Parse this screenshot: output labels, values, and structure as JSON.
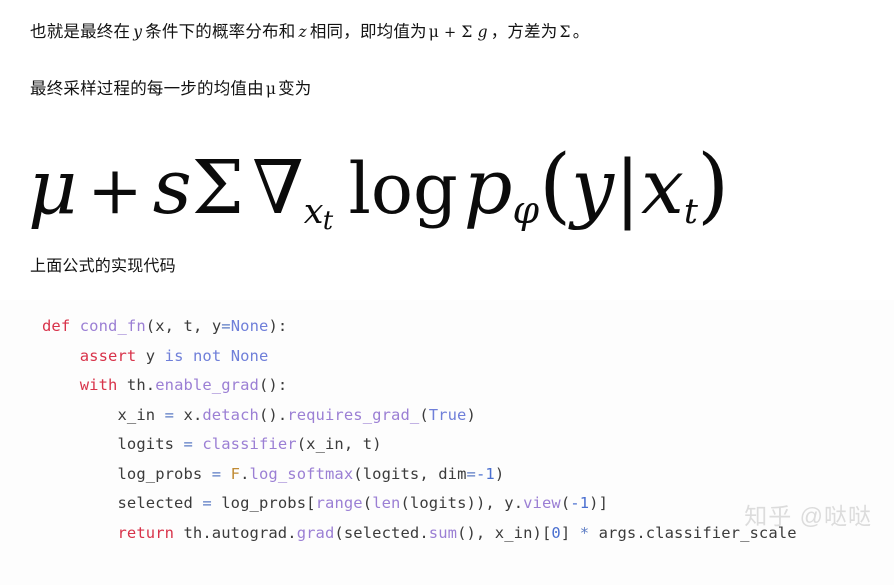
{
  "article": {
    "paragraph_1": {
      "segment_1": "也就是最终在",
      "math_1": "y",
      "segment_2": "条件下的概率分布和",
      "math_2": "z",
      "segment_3": "相同，即均值为",
      "math_3": "μ",
      "math_op": "+",
      "math_4": "Σ",
      "math_5": "g",
      "segment_4": "，方差为",
      "math_6": "Σ",
      "segment_5": "。"
    },
    "paragraph_2": {
      "segment_1": "最终采样过程的每一步的均值由",
      "math_1": "μ",
      "segment_2": "变为"
    },
    "paragraph_3": {
      "text": "上面公式的实现代码"
    }
  },
  "formula": {
    "latex": "\\mu + s\\Sigma \\nabla_{x_t} \\log p_\\phi(y|x_t)",
    "plain": "μ + sΣ ∇_{x_t} log p_φ(y|x_t)",
    "tokens": {
      "mu": "μ",
      "plus": "+",
      "s": "s",
      "sigma": "Σ",
      "nabla": "∇",
      "nabla_sub_x": "x",
      "nabla_sub_t": "t",
      "log": "log",
      "p": "p",
      "phi": "φ",
      "lparen": "(",
      "y": "y",
      "bar": "|",
      "x": "x",
      "x_sub_t": "t",
      "rparen": ")"
    }
  },
  "code": {
    "language": "python",
    "lines": [
      {
        "indent": 0,
        "tokens": [
          {
            "t": "def",
            "c": "t-kw"
          },
          {
            "t": " ",
            "c": "t-punc"
          },
          {
            "t": "cond_fn",
            "c": "t-fn"
          },
          {
            "t": "(",
            "c": "t-punc"
          },
          {
            "t": "x",
            "c": "t-var"
          },
          {
            "t": ", ",
            "c": "t-punc"
          },
          {
            "t": "t",
            "c": "t-var"
          },
          {
            "t": ", ",
            "c": "t-punc"
          },
          {
            "t": "y",
            "c": "t-var"
          },
          {
            "t": "=",
            "c": "t-op"
          },
          {
            "t": "None",
            "c": "t-bi"
          },
          {
            "t": "):",
            "c": "t-punc"
          }
        ]
      },
      {
        "indent": 1,
        "tokens": [
          {
            "t": "assert",
            "c": "t-kw"
          },
          {
            "t": " ",
            "c": "t-punc"
          },
          {
            "t": "y",
            "c": "t-var"
          },
          {
            "t": " ",
            "c": "t-punc"
          },
          {
            "t": "is",
            "c": "t-bi"
          },
          {
            "t": " ",
            "c": "t-punc"
          },
          {
            "t": "not",
            "c": "t-bi"
          },
          {
            "t": " ",
            "c": "t-punc"
          },
          {
            "t": "None",
            "c": "t-bi"
          }
        ]
      },
      {
        "indent": 1,
        "tokens": [
          {
            "t": "with",
            "c": "t-kw"
          },
          {
            "t": " th.",
            "c": "t-punc"
          },
          {
            "t": "enable_grad",
            "c": "t-fn"
          },
          {
            "t": "():",
            "c": "t-punc"
          }
        ]
      },
      {
        "indent": 2,
        "tokens": [
          {
            "t": "x_in",
            "c": "t-var"
          },
          {
            "t": " ",
            "c": "t-punc"
          },
          {
            "t": "=",
            "c": "t-op"
          },
          {
            "t": " x.",
            "c": "t-punc"
          },
          {
            "t": "detach",
            "c": "t-fn"
          },
          {
            "t": "().",
            "c": "t-punc"
          },
          {
            "t": "requires_grad_",
            "c": "t-fn"
          },
          {
            "t": "(",
            "c": "t-punc"
          },
          {
            "t": "True",
            "c": "t-bi"
          },
          {
            "t": ")",
            "c": "t-punc"
          }
        ]
      },
      {
        "indent": 2,
        "tokens": [
          {
            "t": "logits",
            "c": "t-var"
          },
          {
            "t": " ",
            "c": "t-punc"
          },
          {
            "t": "=",
            "c": "t-op"
          },
          {
            "t": " ",
            "c": "t-punc"
          },
          {
            "t": "classifier",
            "c": "t-fn"
          },
          {
            "t": "(",
            "c": "t-punc"
          },
          {
            "t": "x_in",
            "c": "t-var"
          },
          {
            "t": ", ",
            "c": "t-punc"
          },
          {
            "t": "t",
            "c": "t-var"
          },
          {
            "t": ")",
            "c": "t-punc"
          }
        ]
      },
      {
        "indent": 2,
        "tokens": [
          {
            "t": "log_probs",
            "c": "t-var"
          },
          {
            "t": " ",
            "c": "t-punc"
          },
          {
            "t": "=",
            "c": "t-op"
          },
          {
            "t": " ",
            "c": "t-punc"
          },
          {
            "t": "F",
            "c": "t-mod"
          },
          {
            "t": ".",
            "c": "t-punc"
          },
          {
            "t": "log_softmax",
            "c": "t-fn"
          },
          {
            "t": "(",
            "c": "t-punc"
          },
          {
            "t": "logits",
            "c": "t-var"
          },
          {
            "t": ", ",
            "c": "t-punc"
          },
          {
            "t": "dim",
            "c": "t-var"
          },
          {
            "t": "=",
            "c": "t-op"
          },
          {
            "t": "-1",
            "c": "t-num"
          },
          {
            "t": ")",
            "c": "t-punc"
          }
        ]
      },
      {
        "indent": 2,
        "tokens": [
          {
            "t": "selected",
            "c": "t-var"
          },
          {
            "t": " ",
            "c": "t-punc"
          },
          {
            "t": "=",
            "c": "t-op"
          },
          {
            "t": " ",
            "c": "t-punc"
          },
          {
            "t": "log_probs",
            "c": "t-var"
          },
          {
            "t": "[",
            "c": "t-punc"
          },
          {
            "t": "range",
            "c": "t-fn"
          },
          {
            "t": "(",
            "c": "t-punc"
          },
          {
            "t": "len",
            "c": "t-fn"
          },
          {
            "t": "(",
            "c": "t-punc"
          },
          {
            "t": "logits",
            "c": "t-var"
          },
          {
            "t": ")), ",
            "c": "t-punc"
          },
          {
            "t": "y",
            "c": "t-var"
          },
          {
            "t": ".",
            "c": "t-punc"
          },
          {
            "t": "view",
            "c": "t-fn"
          },
          {
            "t": "(",
            "c": "t-punc"
          },
          {
            "t": "-1",
            "c": "t-num"
          },
          {
            "t": ")]",
            "c": "t-punc"
          }
        ]
      },
      {
        "indent": 2,
        "tokens": [
          {
            "t": "return",
            "c": "t-kw"
          },
          {
            "t": " th.autograd.",
            "c": "t-punc"
          },
          {
            "t": "grad",
            "c": "t-fn"
          },
          {
            "t": "(",
            "c": "t-punc"
          },
          {
            "t": "selected",
            "c": "t-var"
          },
          {
            "t": ".",
            "c": "t-punc"
          },
          {
            "t": "sum",
            "c": "t-fn"
          },
          {
            "t": "(), ",
            "c": "t-punc"
          },
          {
            "t": "x_in",
            "c": "t-var"
          },
          {
            "t": ")[",
            "c": "t-punc"
          },
          {
            "t": "0",
            "c": "t-num"
          },
          {
            "t": "] ",
            "c": "t-punc"
          },
          {
            "t": "*",
            "c": "t-op"
          },
          {
            "t": " args.classifier_scale",
            "c": "t-punc"
          }
        ]
      }
    ]
  },
  "watermark": {
    "text": "知乎 @哒哒",
    "color": "#dcdcdc"
  },
  "colors": {
    "page_background": "#ffffff",
    "code_background": "#fdfdfd",
    "text": "#121212",
    "keyword": "#d8334a",
    "function": "#9b7fd4",
    "builtin": "#6f7fd9",
    "operator": "#5c7cc4",
    "number": "#4a6fd0",
    "module": "#c08a33"
  }
}
